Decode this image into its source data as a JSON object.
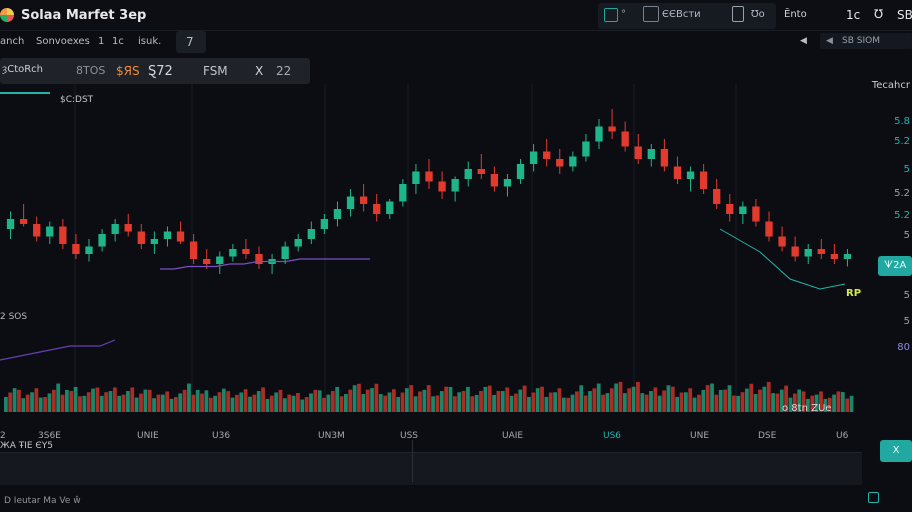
{
  "app": {
    "title": "Solaa Marfet 3ep"
  },
  "topbar": {
    "group_labels": [
      "°",
      "ЄЄВсти"
    ],
    "right_labels": [
      "Ʊo",
      "Ēnto",
      "1c",
      "℧",
      "SB"
    ]
  },
  "toolbar2": {
    "left_items": [
      "anch",
      "Sonvoexes",
      "1",
      "1c",
      "isuk.",
      "7"
    ],
    "right_items": [
      "◀",
      "◀",
      "SB SIOM"
    ]
  },
  "symbolbar": {
    "items": [
      "ȝCtoRch",
      "8TOS",
      "$ЯS",
      "Ȿ72",
      "FSM",
      "X",
      "22"
    ]
  },
  "chart": {
    "legend_label": "$C:DST",
    "left_label": "2 SOS",
    "vol_label": "o 8tn ZUe",
    "mini_label": "RPUB",
    "right_axis_top": "Tecahcr",
    "price_labels": [
      "80",
      "5.8",
      "5.2",
      "5",
      "5.2",
      "5.2",
      "5",
      "5",
      "5"
    ],
    "badge_top": "ᗐ2A",
    "badge_bottom": "Ⅹ"
  },
  "timeaxis": {
    "labels": [
      "2",
      "3S6E",
      "UNIE",
      "U36",
      "UN3M",
      "USS",
      "UAIE",
      "US6",
      "UNE",
      "DSE",
      "U6"
    ],
    "sub": "ЖA ŦIE ЄY5"
  },
  "status": {
    "text": "D Ieutar Ma Ve ŵ"
  },
  "chart_data": {
    "type": "candlestick",
    "candles": [
      [
        1.02,
        1.09,
        0.98,
        1.06
      ],
      [
        1.06,
        1.12,
        1.03,
        1.04
      ],
      [
        1.04,
        1.07,
        0.97,
        0.99
      ],
      [
        0.99,
        1.05,
        0.96,
        1.03
      ],
      [
        1.03,
        1.06,
        0.94,
        0.96
      ],
      [
        0.96,
        1.0,
        0.9,
        0.92
      ],
      [
        0.92,
        0.98,
        0.89,
        0.95
      ],
      [
        0.95,
        1.02,
        0.93,
        1.0
      ],
      [
        1.0,
        1.06,
        0.97,
        1.04
      ],
      [
        1.04,
        1.08,
        0.99,
        1.01
      ],
      [
        1.01,
        1.04,
        0.94,
        0.96
      ],
      [
        0.96,
        1.01,
        0.92,
        0.98
      ],
      [
        0.98,
        1.03,
        0.95,
        1.01
      ],
      [
        1.01,
        1.05,
        0.96,
        0.97
      ],
      [
        0.97,
        1.0,
        0.88,
        0.9
      ],
      [
        0.9,
        0.94,
        0.86,
        0.88
      ],
      [
        0.88,
        0.93,
        0.84,
        0.91
      ],
      [
        0.91,
        0.96,
        0.89,
        0.94
      ],
      [
        0.94,
        0.98,
        0.9,
        0.92
      ],
      [
        0.92,
        0.95,
        0.86,
        0.88
      ],
      [
        0.88,
        0.92,
        0.84,
        0.9
      ],
      [
        0.9,
        0.97,
        0.88,
        0.95
      ],
      [
        0.95,
        1.0,
        0.93,
        0.98
      ],
      [
        0.98,
        1.05,
        0.96,
        1.02
      ],
      [
        1.02,
        1.08,
        1.0,
        1.06
      ],
      [
        1.06,
        1.13,
        1.03,
        1.1
      ],
      [
        1.1,
        1.18,
        1.07,
        1.15
      ],
      [
        1.15,
        1.2,
        1.09,
        1.12
      ],
      [
        1.12,
        1.16,
        1.05,
        1.08
      ],
      [
        1.08,
        1.14,
        1.06,
        1.13
      ],
      [
        1.13,
        1.22,
        1.11,
        1.2
      ],
      [
        1.2,
        1.28,
        1.16,
        1.25
      ],
      [
        1.25,
        1.3,
        1.18,
        1.21
      ],
      [
        1.21,
        1.25,
        1.14,
        1.17
      ],
      [
        1.17,
        1.23,
        1.13,
        1.22
      ],
      [
        1.22,
        1.29,
        1.19,
        1.26
      ],
      [
        1.26,
        1.32,
        1.22,
        1.24
      ],
      [
        1.24,
        1.27,
        1.17,
        1.19
      ],
      [
        1.19,
        1.24,
        1.15,
        1.22
      ],
      [
        1.22,
        1.3,
        1.2,
        1.28
      ],
      [
        1.28,
        1.36,
        1.25,
        1.33
      ],
      [
        1.33,
        1.38,
        1.27,
        1.3
      ],
      [
        1.3,
        1.34,
        1.24,
        1.27
      ],
      [
        1.27,
        1.33,
        1.25,
        1.31
      ],
      [
        1.31,
        1.4,
        1.29,
        1.37
      ],
      [
        1.37,
        1.46,
        1.34,
        1.43
      ],
      [
        1.43,
        1.5,
        1.38,
        1.41
      ],
      [
        1.41,
        1.45,
        1.33,
        1.35
      ],
      [
        1.35,
        1.4,
        1.28,
        1.3
      ],
      [
        1.3,
        1.36,
        1.27,
        1.34
      ],
      [
        1.34,
        1.38,
        1.25,
        1.27
      ],
      [
        1.27,
        1.31,
        1.2,
        1.22
      ],
      [
        1.22,
        1.27,
        1.17,
        1.25
      ],
      [
        1.25,
        1.28,
        1.16,
        1.18
      ],
      [
        1.18,
        1.22,
        1.1,
        1.12
      ],
      [
        1.12,
        1.16,
        1.05,
        1.08
      ],
      [
        1.08,
        1.13,
        1.04,
        1.11
      ],
      [
        1.11,
        1.14,
        1.03,
        1.05
      ],
      [
        1.05,
        1.09,
        0.97,
        0.99
      ],
      [
        0.99,
        1.03,
        0.93,
        0.95
      ],
      [
        0.95,
        0.99,
        0.89,
        0.91
      ],
      [
        0.91,
        0.96,
        0.88,
        0.94
      ],
      [
        0.94,
        0.98,
        0.9,
        0.92
      ],
      [
        0.92,
        0.96,
        0.88,
        0.9
      ],
      [
        0.9,
        0.94,
        0.87,
        0.92
      ]
    ],
    "overlay_line": [
      0.86,
      0.86,
      0.87,
      0.87,
      0.87,
      0.88,
      0.88,
      0.89,
      0.89,
      0.89,
      0.9,
      0.9,
      0.9,
      0.9,
      0.9,
      0.9
    ],
    "ylim": [
      0.6,
      1.6
    ]
  }
}
